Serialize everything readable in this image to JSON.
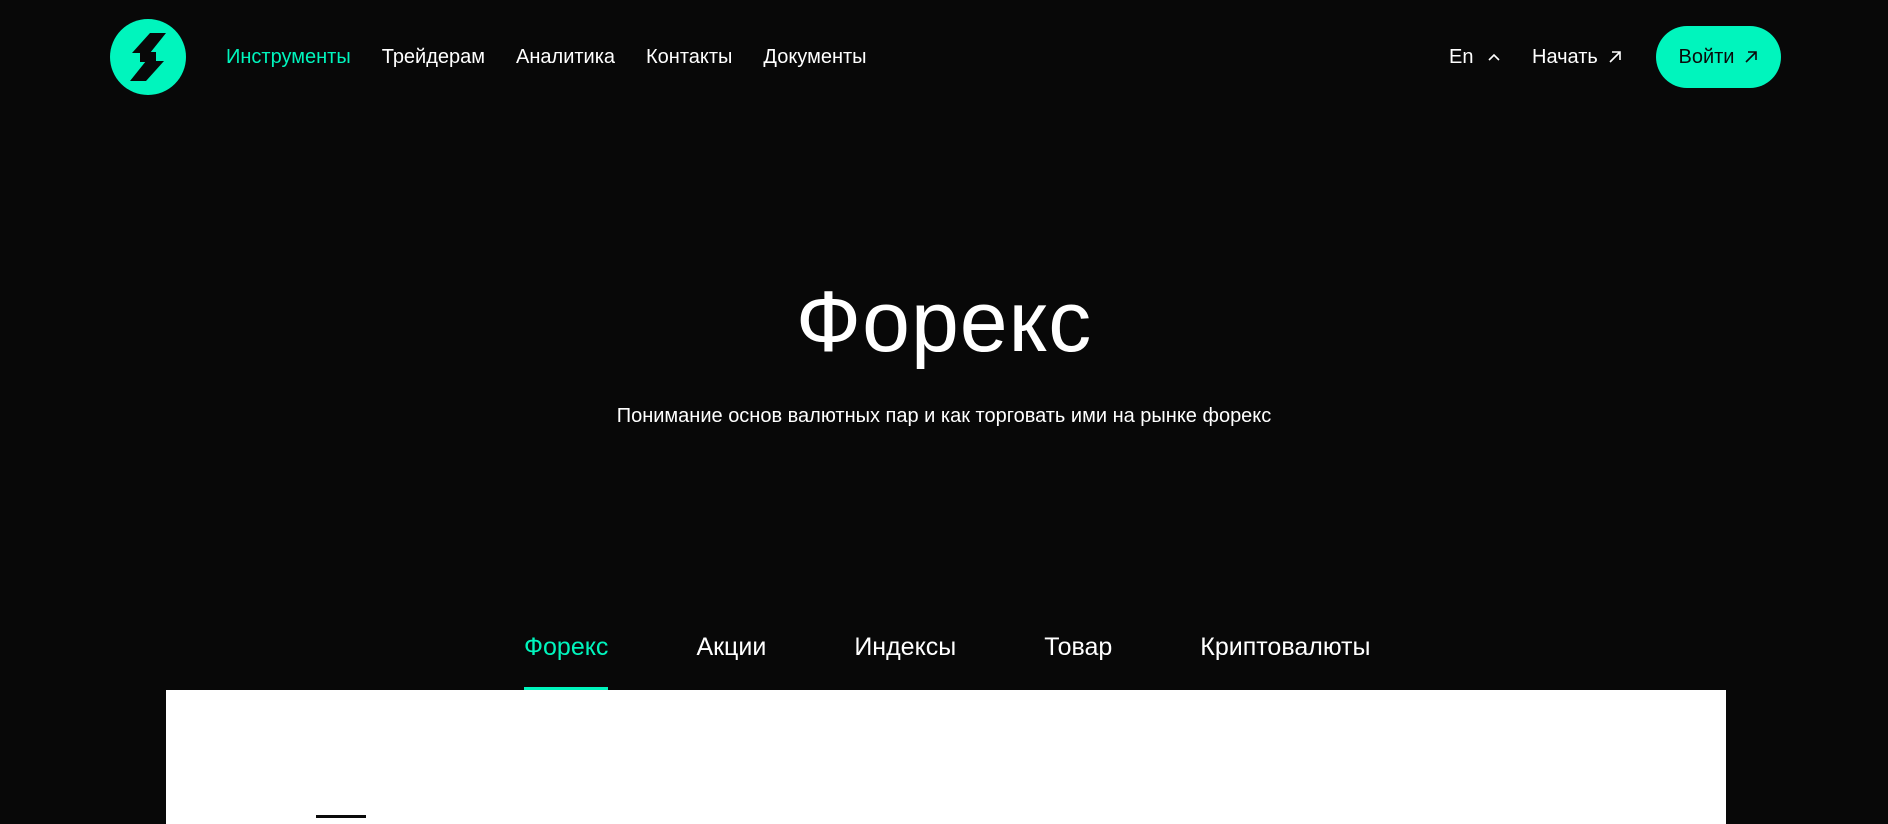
{
  "header": {
    "logo": {
      "icon": "brand-logo-icon",
      "color": "#00f5bd"
    },
    "nav": [
      {
        "label": "Инструменты",
        "active": true
      },
      {
        "label": "Трейдерам",
        "active": false
      },
      {
        "label": "Аналитика",
        "active": false
      },
      {
        "label": "Контакты",
        "active": false
      },
      {
        "label": "Документы",
        "active": false
      }
    ],
    "language": {
      "label": "En",
      "icon": "chevron-up-icon"
    },
    "start": {
      "label": "Начать",
      "icon": "arrow-up-right-icon"
    },
    "login": {
      "label": "Войти",
      "icon": "arrow-up-right-icon"
    }
  },
  "hero": {
    "title": "Форекс",
    "subtitle": "Понимание основ валютных пар и как торговать ими на рынке форекс"
  },
  "tabs": [
    {
      "label": "Форекс",
      "active": true
    },
    {
      "label": "Акции",
      "active": false
    },
    {
      "label": "Индексы",
      "active": false
    },
    {
      "label": "Товар",
      "active": false
    },
    {
      "label": "Криптовалюты",
      "active": false
    }
  ],
  "colors": {
    "background": "#080808",
    "accent": "#00f5bd",
    "text": "#ffffff",
    "panel": "#ffffff"
  }
}
